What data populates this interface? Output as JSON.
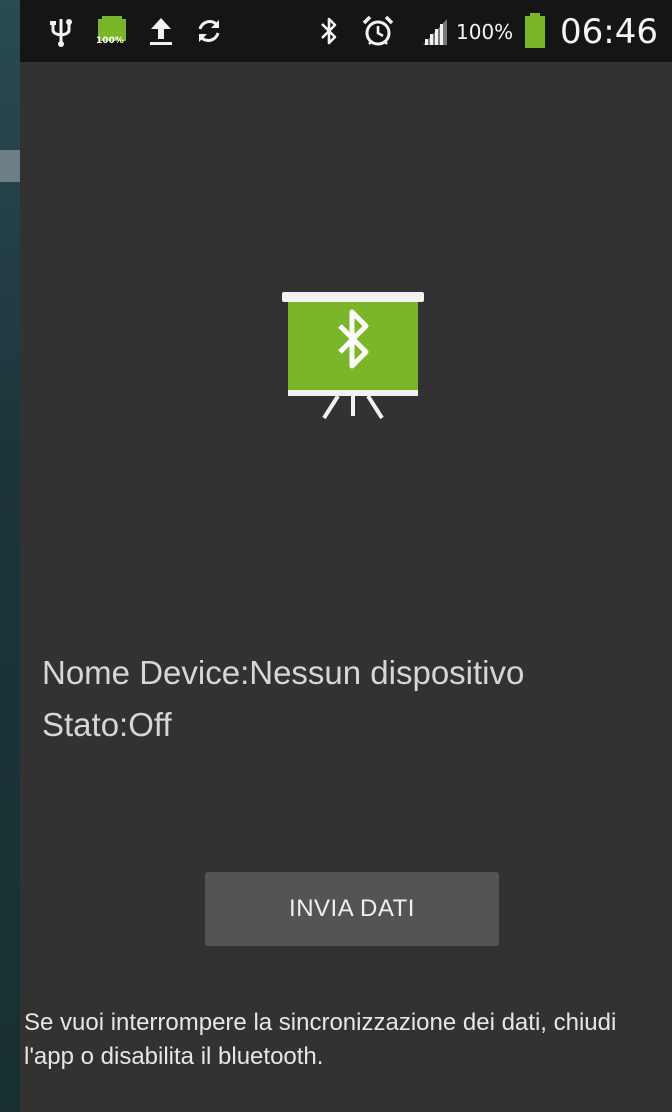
{
  "status_bar": {
    "icons": [
      "usb-icon",
      "battery-full-notification-icon",
      "upload-icon",
      "sync-icon",
      "bluetooth-icon",
      "alarm-icon",
      "signal-icon",
      "battery-icon"
    ],
    "mini_battery_label": "100%",
    "battery_percent": "100%",
    "time": "06:46"
  },
  "main": {
    "logo_icon": "bluetooth-projector-icon",
    "device_name_line": "Nome Device:Nessun dispositivo",
    "status_line": "Stato:Off",
    "send_button_label": "INVIA DATI",
    "footer_note": "Se vuoi interrompere la sincronizzazione dei dati, chiudi l'app o disabilita il bluetooth."
  },
  "colors": {
    "accent_green": "#7bb52a",
    "background": "#323232",
    "status_bar": "#151515",
    "button": "#545454"
  }
}
